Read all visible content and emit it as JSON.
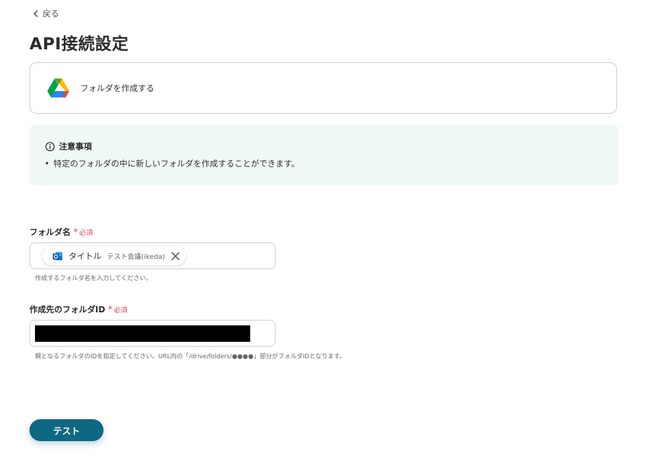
{
  "nav": {
    "back_label": "戻る"
  },
  "page": {
    "title": "API接続設定"
  },
  "action": {
    "label": "フォルダを作成する",
    "icon": "google-drive-icon"
  },
  "notice": {
    "heading": "注意事項",
    "items": [
      "特定のフォルダの中に新しいフォルダを作成することができます。"
    ]
  },
  "fields": {
    "folder_name": {
      "label": "フォルダ名",
      "required_label": "必須",
      "chip": {
        "name": "タイトル",
        "value": "テスト会議(ikeda)",
        "icon": "outlook-icon"
      },
      "help": "作成するフォルダ名を入力してください。"
    },
    "parent_folder_id": {
      "label": "作成先のフォルダID",
      "required_label": "必須",
      "value_redacted": true,
      "help": "親となるフォルダのIDを指定してください。URL内の「/drive/folders/●●●●」部分がフォルダIDとなります。"
    }
  },
  "buttons": {
    "test_label": "テスト"
  },
  "colors": {
    "primary": "#0f6882",
    "required": "#e0445a",
    "notice_bg": "#f0f8f7",
    "border": "#c9ccd1"
  }
}
